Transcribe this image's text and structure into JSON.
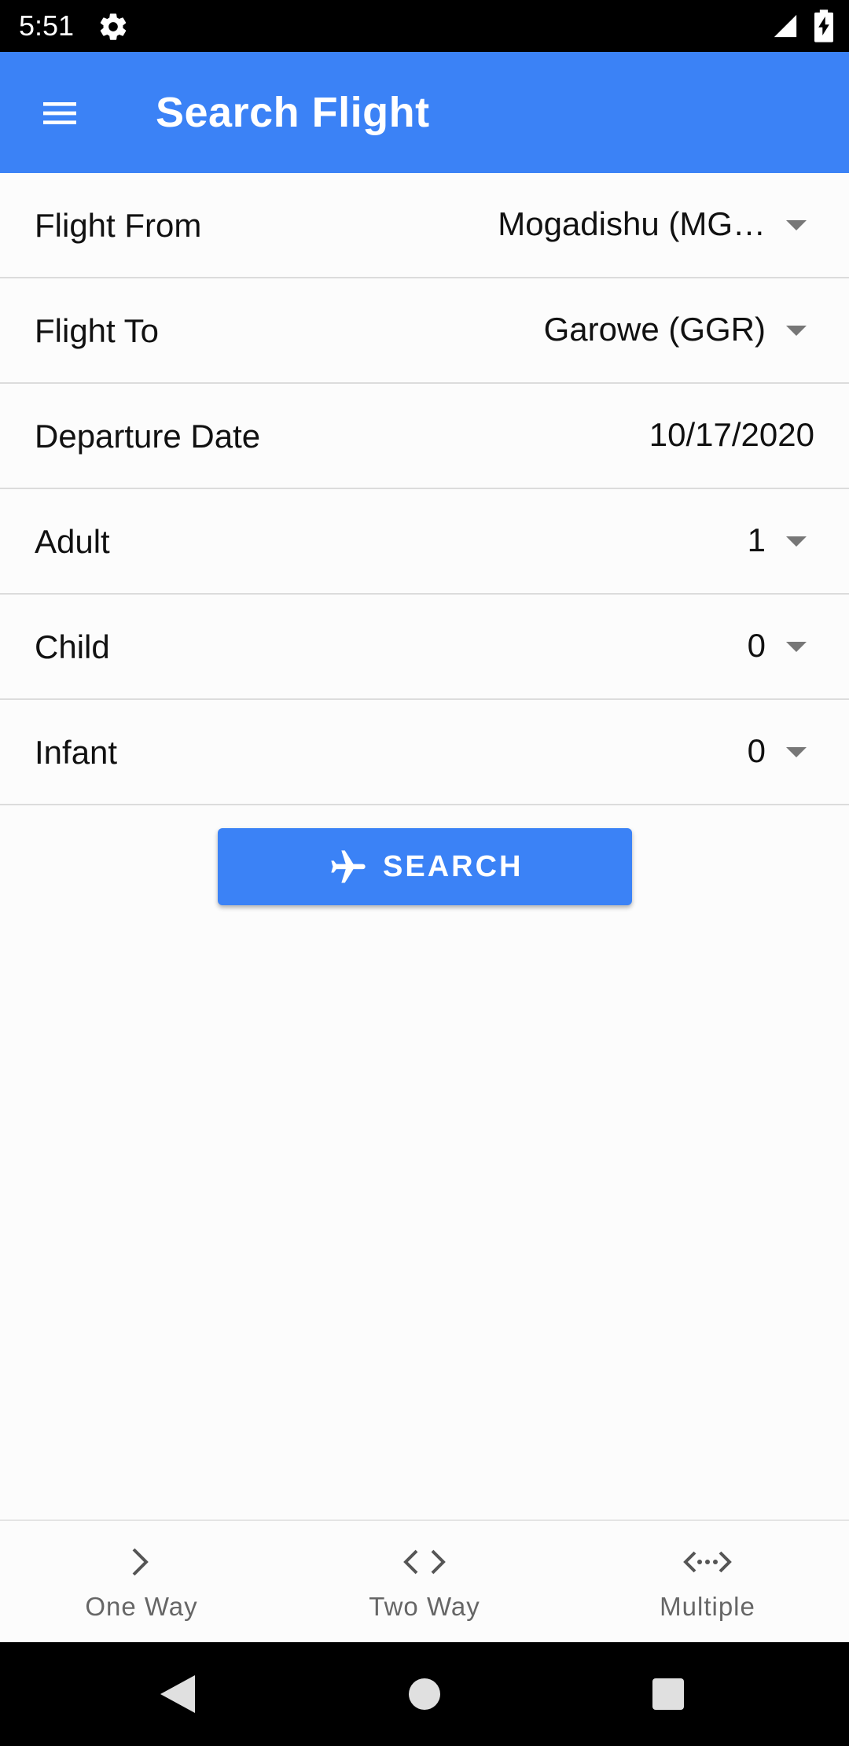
{
  "status_bar": {
    "time": "5:51"
  },
  "app_bar": {
    "title": "Search Flight"
  },
  "form": {
    "rows": [
      {
        "label": "Flight From",
        "value": "Mogadishu (MG…"
      },
      {
        "label": "Flight To",
        "value": "Garowe (GGR)"
      },
      {
        "label": "Departure Date",
        "value": "10/17/2020"
      },
      {
        "label": "Adult",
        "value": "1"
      },
      {
        "label": "Child",
        "value": "0"
      },
      {
        "label": "Infant",
        "value": "0"
      }
    ]
  },
  "search_button": {
    "label": "SEARCH"
  },
  "bottom_nav": {
    "items": [
      {
        "label": "One Way",
        "icon": "chevron-right-icon"
      },
      {
        "label": "Two Way",
        "icon": "code-icon"
      },
      {
        "label": "Multiple",
        "icon": "settings-ethernet-icon"
      }
    ]
  },
  "colors": {
    "primary": "#3b82f6",
    "status_bar": "#000000",
    "background": "#fcfcfc"
  }
}
